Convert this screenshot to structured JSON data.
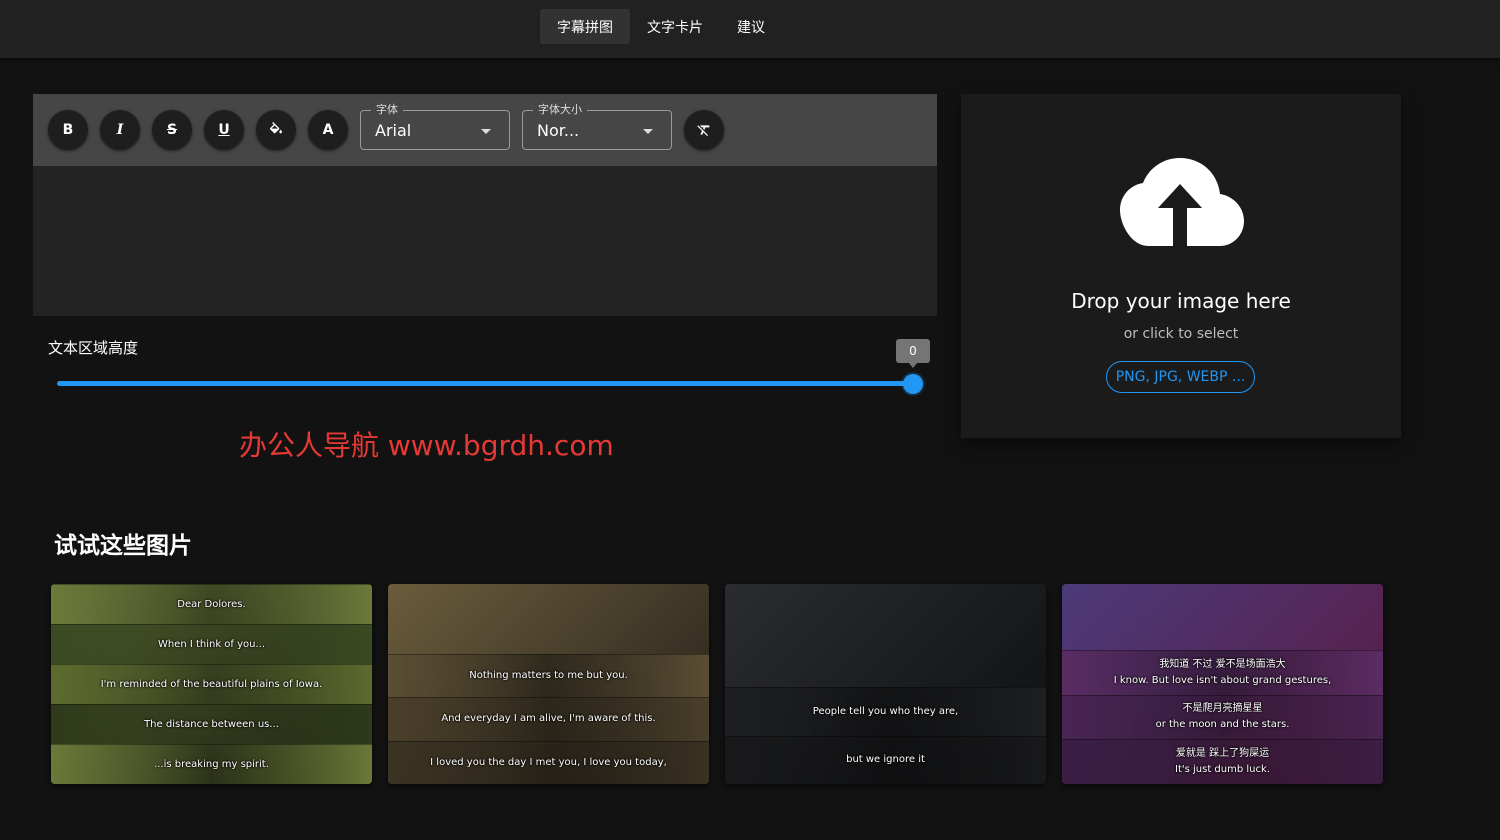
{
  "nav": {
    "tabs": [
      {
        "label": "字幕拼图"
      },
      {
        "label": "文字卡片"
      },
      {
        "label": "建议"
      }
    ]
  },
  "toolbar": {
    "bold": "B",
    "italic": "I",
    "strike": "S",
    "underline": "U",
    "textcolor": "A",
    "font": {
      "legend": "字体",
      "value": "Arial"
    },
    "size": {
      "legend": "字体大小",
      "value": "Nor..."
    }
  },
  "slider": {
    "label": "文本区域高度",
    "value": "0"
  },
  "watermark": "办公人导航 www.bgrdh.com",
  "dropzone": {
    "title": "Drop your image here",
    "subtitle": "or click to select",
    "formats": "PNG, JPG, WEBP ..."
  },
  "examples": {
    "title": "试试这些图片",
    "cards": [
      {
        "captions": [
          [
            "Dear Dolores."
          ],
          [
            "When I think of you..."
          ],
          [
            "I'm reminded of the beautiful plains of Iowa."
          ],
          [
            "The distance between us..."
          ],
          [
            "...is breaking my spirit."
          ]
        ]
      },
      {
        "captions": [
          [
            "Nothing matters to me but you."
          ],
          [
            "And everyday I am alive, I'm aware of this."
          ],
          [
            "I loved you the day I met you, I love you today,"
          ]
        ]
      },
      {
        "captions": [
          [
            "People tell you who they are,"
          ],
          [
            "but we ignore it"
          ]
        ]
      },
      {
        "captions": [
          [
            "我知道 不过 爱不是场面浩大",
            "I know. But love isn't about grand gestures,"
          ],
          [
            "不是爬月亮摘星星",
            "or the moon and the stars."
          ],
          [
            "爱就是 踩上了狗屎运",
            "It's just dumb luck."
          ]
        ]
      }
    ]
  },
  "colors": {
    "accent": "#2196f3",
    "watermark": "#e53935",
    "background": "#121212"
  }
}
